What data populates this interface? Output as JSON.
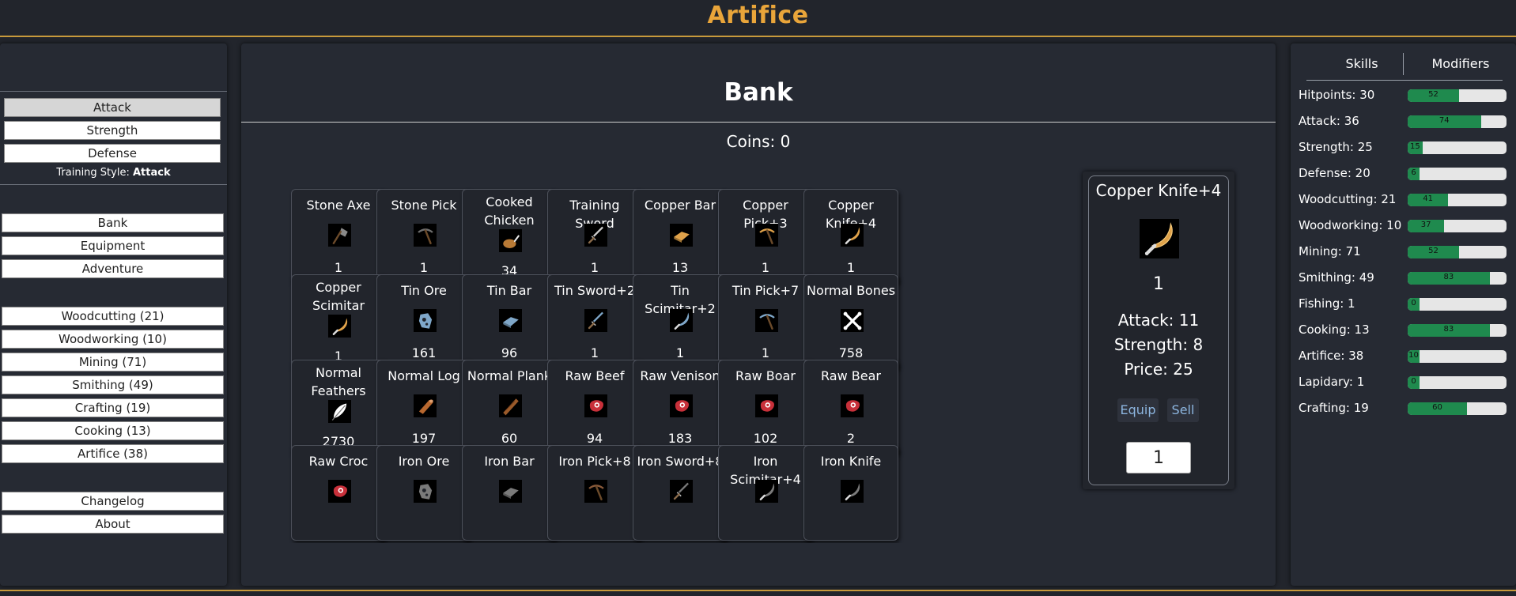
{
  "app": {
    "title": "Artifice"
  },
  "training": {
    "styles": [
      "Attack",
      "Strength",
      "Defense"
    ],
    "active": "Attack",
    "prefix": "Training Style:",
    "value": "Attack"
  },
  "nav": {
    "main": [
      "Bank",
      "Equipment",
      "Adventure"
    ],
    "skills": [
      "Woodcutting (21)",
      "Woodworking (10)",
      "Mining (71)",
      "Smithing (49)",
      "Crafting (19)",
      "Cooking (13)",
      "Artifice (38)"
    ],
    "info": [
      "Changelog",
      "About"
    ]
  },
  "bank": {
    "title": "Bank",
    "coins": "Coins: 0",
    "items": [
      {
        "name": "Stone Axe",
        "qty": "1",
        "icon": "axe-icon",
        "color": "#8a8a8a"
      },
      {
        "name": "Stone Pick",
        "qty": "1",
        "icon": "pickaxe-icon",
        "color": "#6e6e6e"
      },
      {
        "name": "Cooked Chicken",
        "qty": "34",
        "icon": "chicken-icon",
        "color": "#b87a36"
      },
      {
        "name": "Training Sword",
        "qty": "1",
        "icon": "sword-icon",
        "color": "#cfcfcf"
      },
      {
        "name": "Copper Bar",
        "qty": "13",
        "icon": "bar-icon",
        "color": "#e0a24a"
      },
      {
        "name": "Copper Pick+3",
        "qty": "1",
        "icon": "pickaxe-icon",
        "color": "#e0a24a"
      },
      {
        "name": "Copper Knife+4",
        "qty": "1",
        "icon": "scimitar-icon",
        "color": "#e0a24a"
      },
      {
        "name": "Copper Scimitar",
        "qty": "1",
        "icon": "scimitar-icon",
        "color": "#e0a24a"
      },
      {
        "name": "Tin Ore",
        "qty": "161",
        "icon": "ore-icon",
        "color": "#7fa7c9"
      },
      {
        "name": "Tin Bar",
        "qty": "96",
        "icon": "bar-icon",
        "color": "#7fa7c9"
      },
      {
        "name": "Tin Sword+2",
        "qty": "1",
        "icon": "sword-icon",
        "color": "#7fa7c9"
      },
      {
        "name": "Tin Scimitar+2",
        "qty": "1",
        "icon": "scimitar-icon",
        "color": "#7fa7c9"
      },
      {
        "name": "Tin Pick+7",
        "qty": "1",
        "icon": "pickaxe-icon",
        "color": "#7fa7c9"
      },
      {
        "name": "Normal Bones",
        "qty": "758",
        "icon": "bones-icon",
        "color": "#ffffff"
      },
      {
        "name": "Normal Feathers",
        "qty": "2730",
        "icon": "feather-icon",
        "color": "#ffffff"
      },
      {
        "name": "Normal Log",
        "qty": "197",
        "icon": "log-icon",
        "color": "#b8682f"
      },
      {
        "name": "Normal Plank",
        "qty": "60",
        "icon": "plank-icon",
        "color": "#9a5a2a"
      },
      {
        "name": "Raw Beef",
        "qty": "94",
        "icon": "meat-icon",
        "color": "#c8303a"
      },
      {
        "name": "Raw Venison",
        "qty": "183",
        "icon": "meat-icon",
        "color": "#c8303a"
      },
      {
        "name": "Raw Boar",
        "qty": "102",
        "icon": "meat-icon",
        "color": "#c8303a"
      },
      {
        "name": "Raw Bear",
        "qty": "2",
        "icon": "meat-icon",
        "color": "#c8303a"
      },
      {
        "name": "Raw Croc",
        "qty": "",
        "icon": "meat-icon",
        "color": "#c8303a"
      },
      {
        "name": "Iron Ore",
        "qty": "",
        "icon": "ore-icon",
        "color": "#7a7a7a"
      },
      {
        "name": "Iron Bar",
        "qty": "",
        "icon": "bar-icon",
        "color": "#7a7a7a"
      },
      {
        "name": "Iron Pick+8",
        "qty": "",
        "icon": "pickaxe-icon",
        "color": "#8a5a3a"
      },
      {
        "name": "Iron Sword+8",
        "qty": "",
        "icon": "sword-icon",
        "color": "#7a7a7a"
      },
      {
        "name": "Iron Scimitar+4",
        "qty": "",
        "icon": "scimitar-icon",
        "color": "#7a7a7a"
      },
      {
        "name": "Iron Knife",
        "qty": "",
        "icon": "scimitar-icon",
        "color": "#7a7a7a"
      }
    ]
  },
  "detail": {
    "name": "Copper Knife+4",
    "icon": "scimitar-icon",
    "qty": "1",
    "stats": [
      "Attack: 11",
      "Strength: 8",
      "Price: 25"
    ],
    "equip_label": "Equip",
    "sell_label": "Sell",
    "amount": "1"
  },
  "sidebar": {
    "tabs": [
      "Skills",
      "Modifiers"
    ],
    "skills": [
      {
        "label": "Hitpoints: 30",
        "progress": 52
      },
      {
        "label": "Attack: 36",
        "progress": 74
      },
      {
        "label": "Strength: 25",
        "progress": 15
      },
      {
        "label": "Defense: 20",
        "progress": 6
      },
      {
        "label": "Woodcutting: 21",
        "progress": 41
      },
      {
        "label": "Woodworking: 10",
        "progress": 37
      },
      {
        "label": "Mining: 71",
        "progress": 52
      },
      {
        "label": "Smithing: 49",
        "progress": 83
      },
      {
        "label": "Fishing: 1",
        "progress": 0
      },
      {
        "label": "Cooking: 13",
        "progress": 83
      },
      {
        "label": "Artifice: 38",
        "progress": 10
      },
      {
        "label": "Lapidary: 1",
        "progress": 0
      },
      {
        "label": "Crafting: 19",
        "progress": 60
      }
    ]
  },
  "colors": {
    "accent": "#e9a53a",
    "progress": "#1f8a4e",
    "link": "#8db6e0"
  }
}
